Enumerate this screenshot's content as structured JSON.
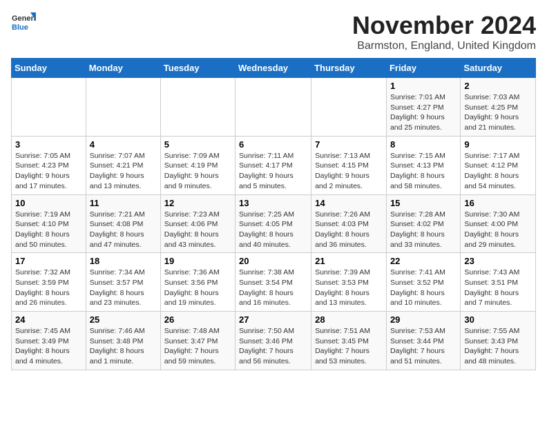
{
  "logo": {
    "general": "General",
    "blue": "Blue"
  },
  "title": "November 2024",
  "location": "Barmston, England, United Kingdom",
  "days_header": [
    "Sunday",
    "Monday",
    "Tuesday",
    "Wednesday",
    "Thursday",
    "Friday",
    "Saturday"
  ],
  "weeks": [
    [
      {
        "day": "",
        "info": ""
      },
      {
        "day": "",
        "info": ""
      },
      {
        "day": "",
        "info": ""
      },
      {
        "day": "",
        "info": ""
      },
      {
        "day": "",
        "info": ""
      },
      {
        "day": "1",
        "info": "Sunrise: 7:01 AM\nSunset: 4:27 PM\nDaylight: 9 hours and 25 minutes."
      },
      {
        "day": "2",
        "info": "Sunrise: 7:03 AM\nSunset: 4:25 PM\nDaylight: 9 hours and 21 minutes."
      }
    ],
    [
      {
        "day": "3",
        "info": "Sunrise: 7:05 AM\nSunset: 4:23 PM\nDaylight: 9 hours and 17 minutes."
      },
      {
        "day": "4",
        "info": "Sunrise: 7:07 AM\nSunset: 4:21 PM\nDaylight: 9 hours and 13 minutes."
      },
      {
        "day": "5",
        "info": "Sunrise: 7:09 AM\nSunset: 4:19 PM\nDaylight: 9 hours and 9 minutes."
      },
      {
        "day": "6",
        "info": "Sunrise: 7:11 AM\nSunset: 4:17 PM\nDaylight: 9 hours and 5 minutes."
      },
      {
        "day": "7",
        "info": "Sunrise: 7:13 AM\nSunset: 4:15 PM\nDaylight: 9 hours and 2 minutes."
      },
      {
        "day": "8",
        "info": "Sunrise: 7:15 AM\nSunset: 4:13 PM\nDaylight: 8 hours and 58 minutes."
      },
      {
        "day": "9",
        "info": "Sunrise: 7:17 AM\nSunset: 4:12 PM\nDaylight: 8 hours and 54 minutes."
      }
    ],
    [
      {
        "day": "10",
        "info": "Sunrise: 7:19 AM\nSunset: 4:10 PM\nDaylight: 8 hours and 50 minutes."
      },
      {
        "day": "11",
        "info": "Sunrise: 7:21 AM\nSunset: 4:08 PM\nDaylight: 8 hours and 47 minutes."
      },
      {
        "day": "12",
        "info": "Sunrise: 7:23 AM\nSunset: 4:06 PM\nDaylight: 8 hours and 43 minutes."
      },
      {
        "day": "13",
        "info": "Sunrise: 7:25 AM\nSunset: 4:05 PM\nDaylight: 8 hours and 40 minutes."
      },
      {
        "day": "14",
        "info": "Sunrise: 7:26 AM\nSunset: 4:03 PM\nDaylight: 8 hours and 36 minutes."
      },
      {
        "day": "15",
        "info": "Sunrise: 7:28 AM\nSunset: 4:02 PM\nDaylight: 8 hours and 33 minutes."
      },
      {
        "day": "16",
        "info": "Sunrise: 7:30 AM\nSunset: 4:00 PM\nDaylight: 8 hours and 29 minutes."
      }
    ],
    [
      {
        "day": "17",
        "info": "Sunrise: 7:32 AM\nSunset: 3:59 PM\nDaylight: 8 hours and 26 minutes."
      },
      {
        "day": "18",
        "info": "Sunrise: 7:34 AM\nSunset: 3:57 PM\nDaylight: 8 hours and 23 minutes."
      },
      {
        "day": "19",
        "info": "Sunrise: 7:36 AM\nSunset: 3:56 PM\nDaylight: 8 hours and 19 minutes."
      },
      {
        "day": "20",
        "info": "Sunrise: 7:38 AM\nSunset: 3:54 PM\nDaylight: 8 hours and 16 minutes."
      },
      {
        "day": "21",
        "info": "Sunrise: 7:39 AM\nSunset: 3:53 PM\nDaylight: 8 hours and 13 minutes."
      },
      {
        "day": "22",
        "info": "Sunrise: 7:41 AM\nSunset: 3:52 PM\nDaylight: 8 hours and 10 minutes."
      },
      {
        "day": "23",
        "info": "Sunrise: 7:43 AM\nSunset: 3:51 PM\nDaylight: 8 hours and 7 minutes."
      }
    ],
    [
      {
        "day": "24",
        "info": "Sunrise: 7:45 AM\nSunset: 3:49 PM\nDaylight: 8 hours and 4 minutes."
      },
      {
        "day": "25",
        "info": "Sunrise: 7:46 AM\nSunset: 3:48 PM\nDaylight: 8 hours and 1 minute."
      },
      {
        "day": "26",
        "info": "Sunrise: 7:48 AM\nSunset: 3:47 PM\nDaylight: 7 hours and 59 minutes."
      },
      {
        "day": "27",
        "info": "Sunrise: 7:50 AM\nSunset: 3:46 PM\nDaylight: 7 hours and 56 minutes."
      },
      {
        "day": "28",
        "info": "Sunrise: 7:51 AM\nSunset: 3:45 PM\nDaylight: 7 hours and 53 minutes."
      },
      {
        "day": "29",
        "info": "Sunrise: 7:53 AM\nSunset: 3:44 PM\nDaylight: 7 hours and 51 minutes."
      },
      {
        "day": "30",
        "info": "Sunrise: 7:55 AM\nSunset: 3:43 PM\nDaylight: 7 hours and 48 minutes."
      }
    ]
  ]
}
